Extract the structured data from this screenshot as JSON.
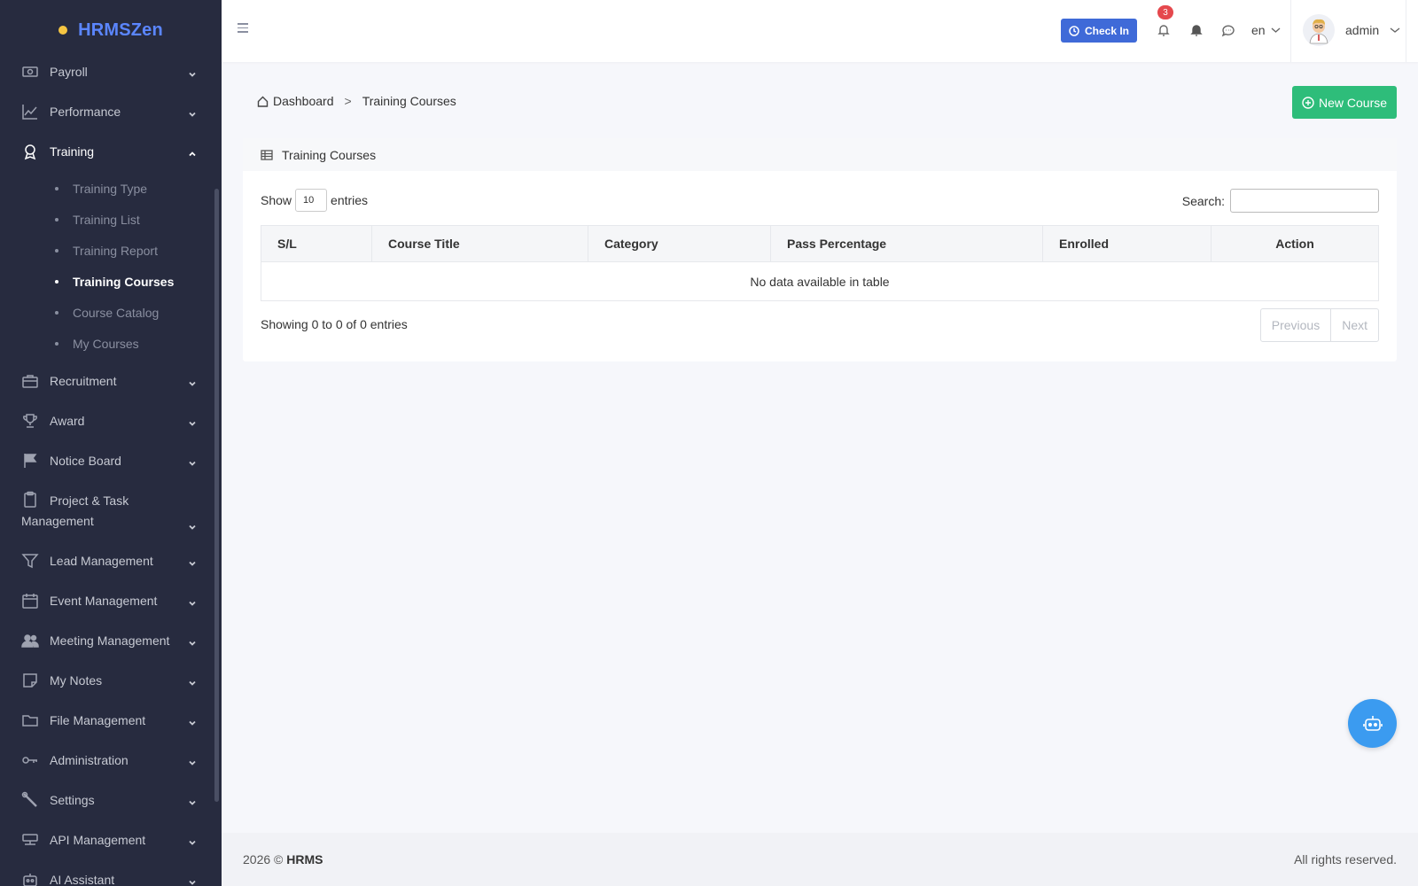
{
  "brand": {
    "name": "HRMSZen"
  },
  "sidebar": {
    "items": [
      {
        "label": "Payroll",
        "icon": "money-icon"
      },
      {
        "label": "Performance",
        "icon": "chart-line-icon"
      },
      {
        "label": "Training",
        "icon": "award-icon",
        "expanded": true,
        "children": [
          {
            "label": "Training Type"
          },
          {
            "label": "Training List"
          },
          {
            "label": "Training Report"
          },
          {
            "label": "Training Courses",
            "active": true
          },
          {
            "label": "Course Catalog"
          },
          {
            "label": "My Courses"
          }
        ]
      },
      {
        "label": "Recruitment",
        "icon": "briefcase-icon"
      },
      {
        "label": "Award",
        "icon": "trophy-icon"
      },
      {
        "label": "Notice Board",
        "icon": "flag-icon"
      },
      {
        "label": "Project & Task Management",
        "icon": "clipboard-icon"
      },
      {
        "label": "Lead Management",
        "icon": "funnel-icon"
      },
      {
        "label": "Event Management",
        "icon": "calendar-icon"
      },
      {
        "label": "Meeting Management",
        "icon": "people-icon"
      },
      {
        "label": "My Notes",
        "icon": "note-icon"
      },
      {
        "label": "File Management",
        "icon": "folder-icon"
      },
      {
        "label": "Administration",
        "icon": "key-icon"
      },
      {
        "label": "Settings",
        "icon": "wrench-icon"
      },
      {
        "label": "API Management",
        "icon": "api-icon"
      },
      {
        "label": "AI Assistant",
        "icon": "robot-icon"
      }
    ]
  },
  "topbar": {
    "checkin_label": "Check In",
    "notification_count": "3",
    "language": "en",
    "username": "admin"
  },
  "breadcrumb": {
    "home": "Dashboard",
    "separator": ">",
    "current": "Training Courses"
  },
  "actions": {
    "new_course_label": "New Course"
  },
  "card": {
    "title": "Training Courses",
    "show_label": "Show",
    "entries_label": "entries",
    "page_length": "10",
    "search_label": "Search:",
    "search_value": "",
    "columns": [
      "S/L",
      "Course Title",
      "Category",
      "Pass Percentage",
      "Enrolled",
      "Action"
    ],
    "empty_message": "No data available in table",
    "info": "Showing 0 to 0 of 0 entries",
    "pager": {
      "previous": "Previous",
      "next": "Next"
    }
  },
  "footer": {
    "year": "2026 ©",
    "brand": "HRMS",
    "rights": "All rights reserved."
  },
  "colors": {
    "sidebar_bg": "#272b3f",
    "brand": "#5b86ff",
    "primary": "#3f6ad8",
    "success": "#2ebd7a",
    "fab": "#3b9bf0",
    "badge": "#e5484d"
  }
}
